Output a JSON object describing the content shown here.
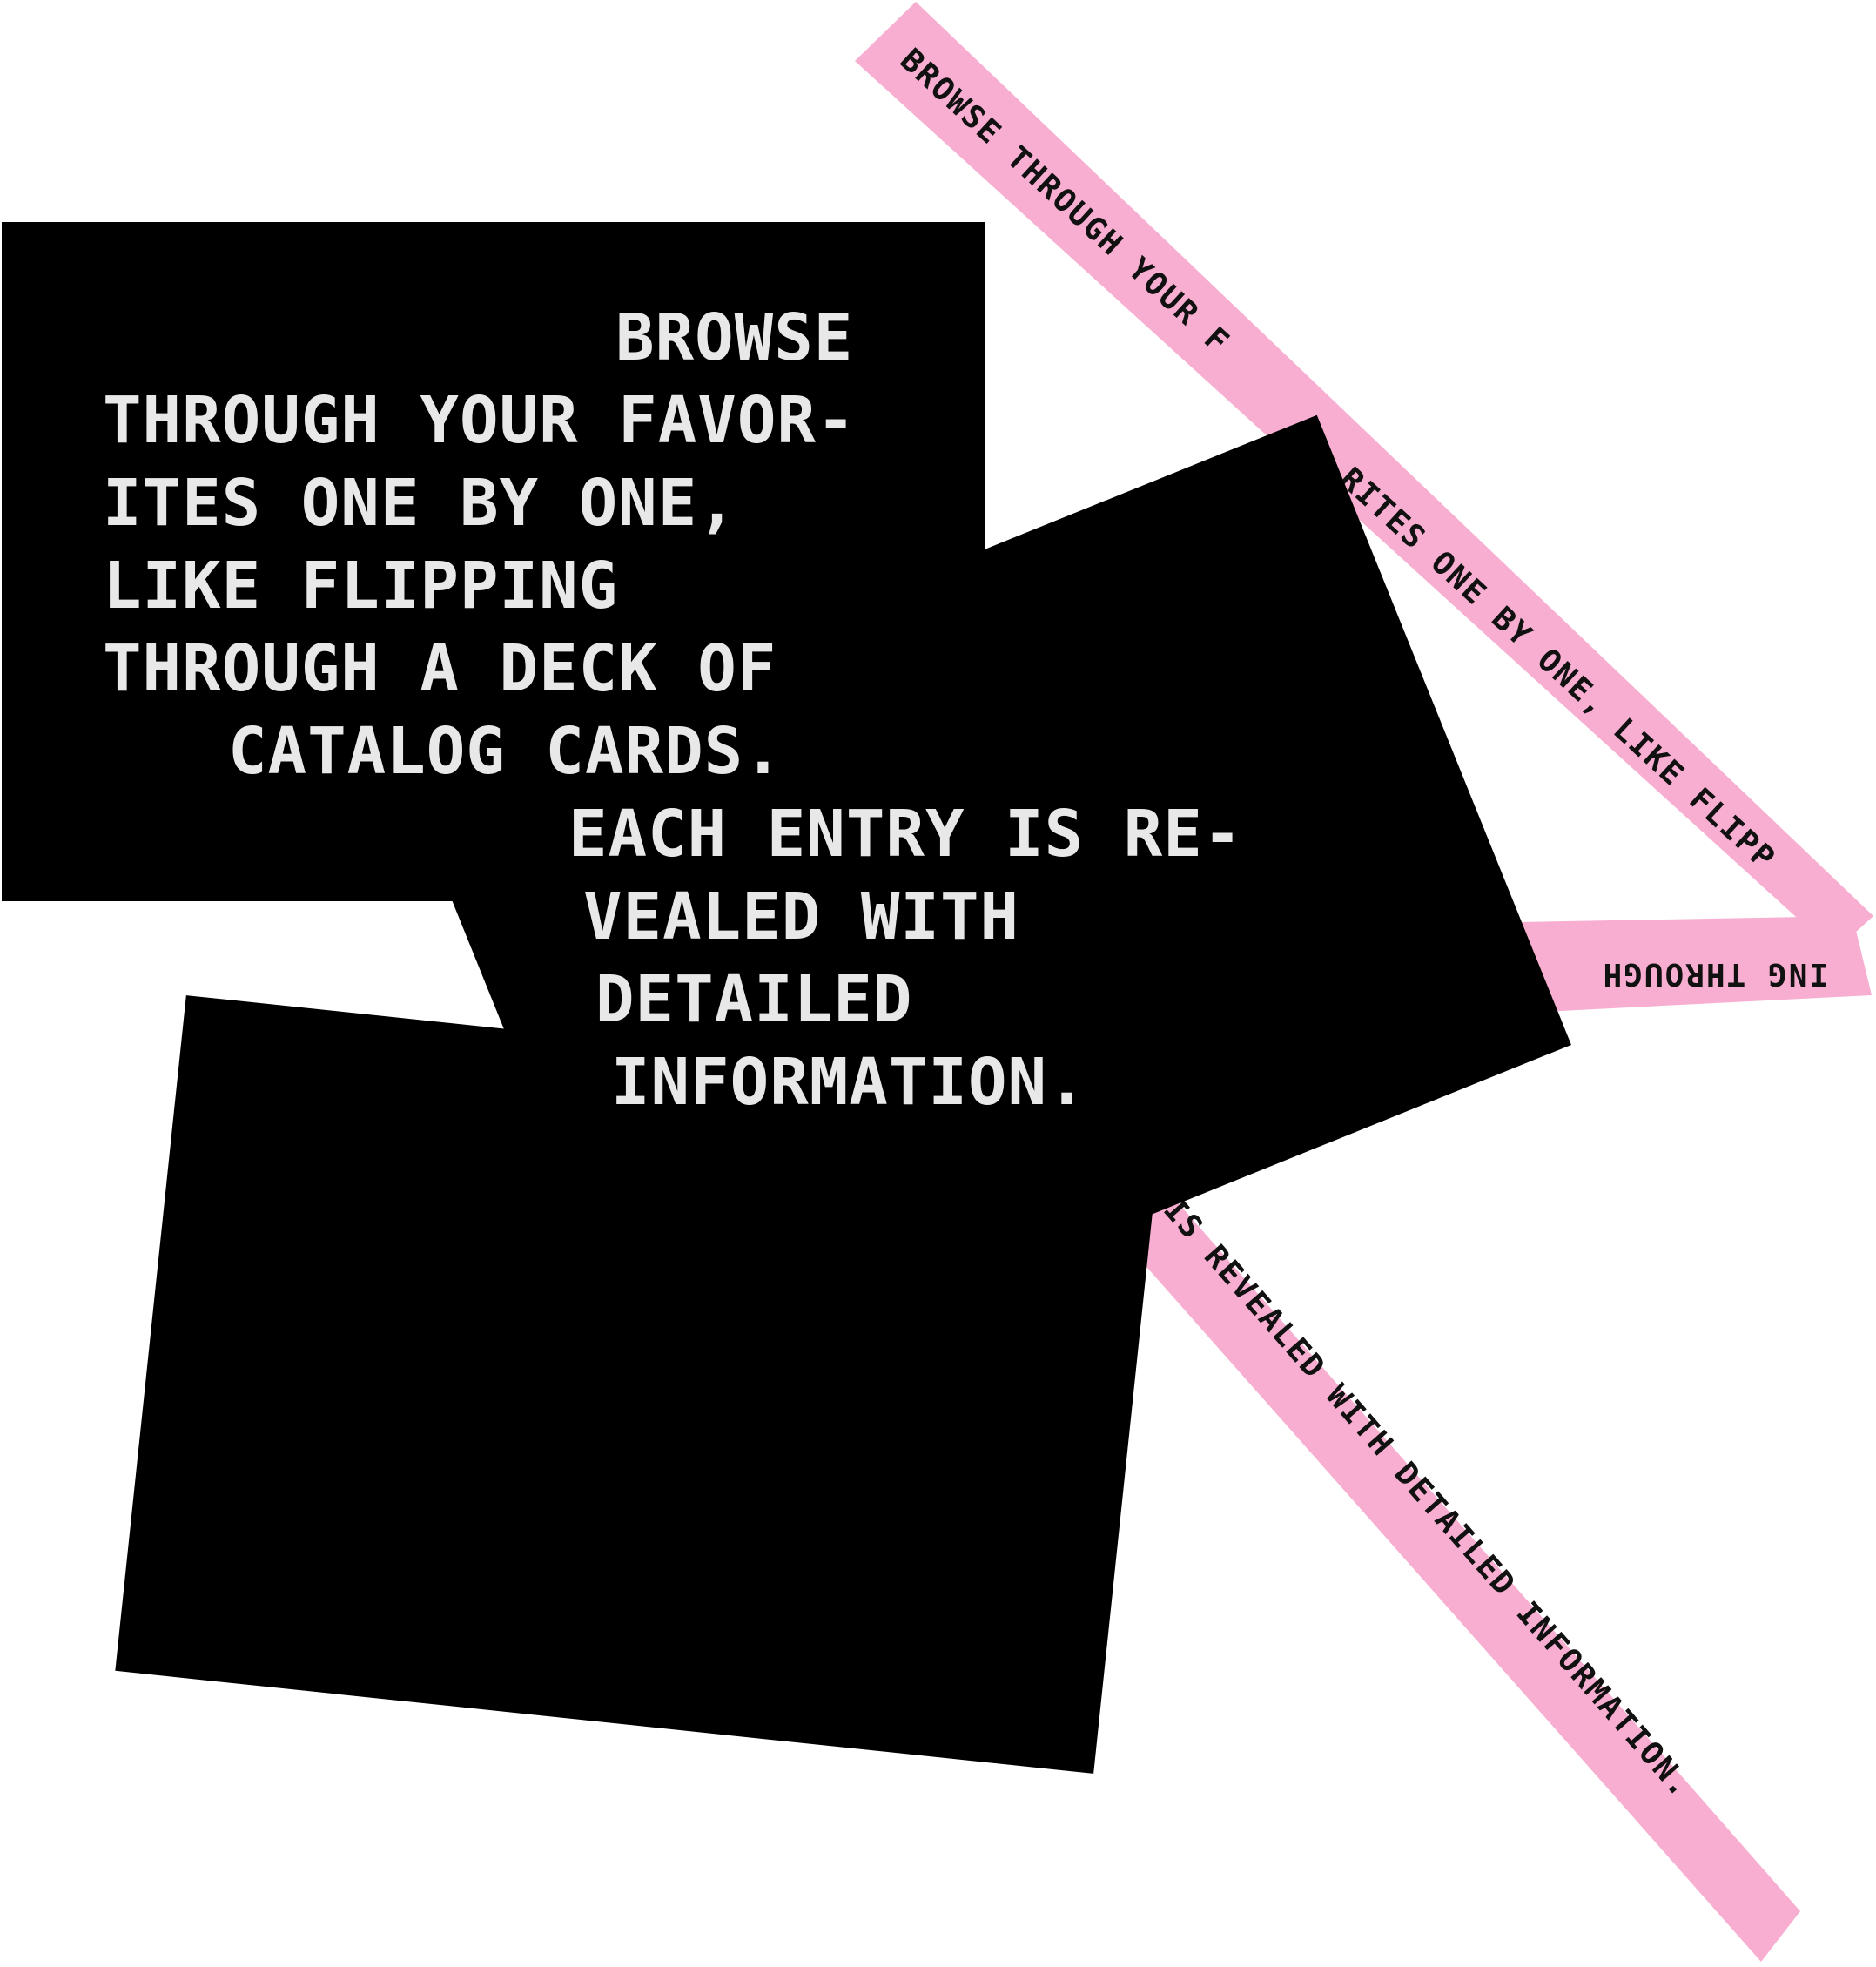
{
  "colors": {
    "background": "#ffffff",
    "card": "#000000",
    "card_text": "#e8e8e8",
    "tape": "#f7aed0",
    "tape_text": "#111111"
  },
  "card_text_a": [
    "BROWSE",
    "THROUGH YOUR FAVOR-",
    "ITES ONE BY ONE,",
    "LIKE FLIPPING",
    "THROUGH A DECK OF",
    "CATALOG CARDS."
  ],
  "card_text_b": [
    "EACH ENTRY IS RE-",
    "VEALED WITH",
    "DETAILED",
    "INFORMATION."
  ],
  "tape_text": {
    "segment1_part1": "BROWSE THROUGH YOUR F",
    "segment1_part2": "RITES ONE BY ONE, LIKE FLIPP",
    "segment2": "ING THROUGH",
    "segment3": "IS REVEALED WITH DETAILED INFORMATION."
  }
}
